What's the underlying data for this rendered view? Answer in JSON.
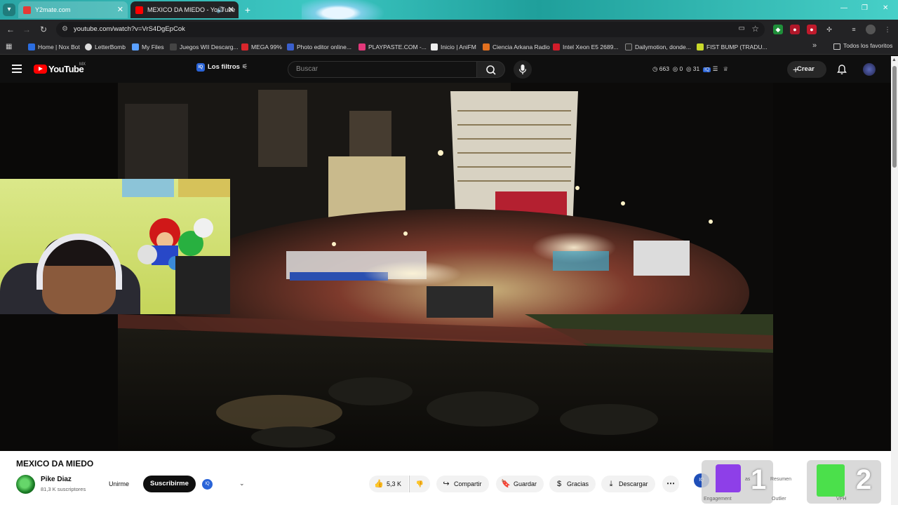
{
  "browser": {
    "tabs": [
      {
        "title": "Y2mate.com",
        "active": false
      },
      {
        "title": "MEXICO DA MIEDO - YouTube",
        "active": true
      }
    ],
    "url": "youtube.com/watch?v=VrS4DgEpCok",
    "bookmarks": [
      "Home | Nox Bot",
      "LetterBomb",
      "My Files",
      "Juegos WII Descarg...",
      "MEGA 99%",
      "Photo editor online...",
      "PLAYPASTE.COM -...",
      "Inicio | AniFM",
      "Ciencia Arkana Radio",
      "Intel Xeon E5 2689...",
      "Dailymotion, donde...",
      "FIST BUMP (TRADU..."
    ],
    "bookmarks_all": "Todos los favoritos"
  },
  "youtube": {
    "logo_text": "YouTube",
    "country": "MX",
    "filters_label": "Los filtros",
    "search_placeholder": "Buscar",
    "stats": {
      "a": "663",
      "b": "0",
      "c": "31"
    },
    "create_label": "Crear"
  },
  "video": {
    "title": "MEXICO DA MIEDO",
    "channel": "Pike Diaz",
    "subscribers": "81,3 K suscriptores",
    "join_label": "Unirme",
    "subscribe_label": "Suscribirme",
    "likes": "5,3 K",
    "share_label": "Compartir",
    "save_label": "Guardar",
    "thanks_label": "Gracias",
    "download_label": "Descargar"
  },
  "overlays": {
    "twitch_count": "1",
    "kick_count": "2",
    "label_engagement": "Engagement",
    "label_resumen": "Resumen",
    "label_outlier": "Outlier",
    "label_vph": "VPH",
    "label_tags": "as"
  },
  "colors": {
    "yt_red": "#ff0000",
    "twitch_purple": "#8e3fe8",
    "kick_green": "#4be04b"
  }
}
